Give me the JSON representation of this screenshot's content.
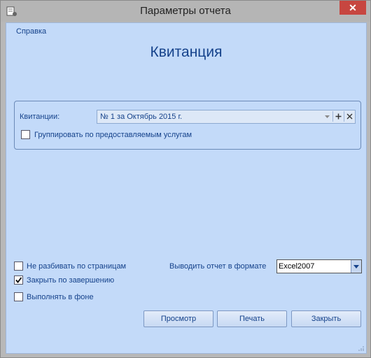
{
  "window": {
    "title": "Параметры отчета",
    "close_glyph": "✕"
  },
  "menu": {
    "help": "Справка"
  },
  "heading": "Квитанция",
  "receipt_group": {
    "label": "Квитанции:",
    "selected": "№ 1 за Октябрь 2015 г.",
    "group_by_services": {
      "label": "Группировать по предоставляемым услугам",
      "checked": false
    }
  },
  "options": {
    "no_page_split": {
      "label": "Не разбивать по страницам",
      "checked": false
    },
    "close_on_finish": {
      "label": "Закрыть по завершению",
      "checked": true
    },
    "run_in_background": {
      "label": "Выполнять в фоне",
      "checked": false
    }
  },
  "format": {
    "label": "Выводить отчет в формате",
    "value": "Excel2007"
  },
  "buttons": {
    "preview": "Просмотр",
    "print": "Печать",
    "close": "Закрыть"
  },
  "icons": {
    "app": "report-settings-icon",
    "close": "close-icon",
    "dropdown": "chevron-down-icon",
    "add": "plus-icon",
    "clear": "x-icon",
    "check": "checkmark-icon"
  },
  "colors": {
    "accent_text": "#15428b",
    "client_bg": "#c3daf9",
    "close_button": "#c74640"
  }
}
